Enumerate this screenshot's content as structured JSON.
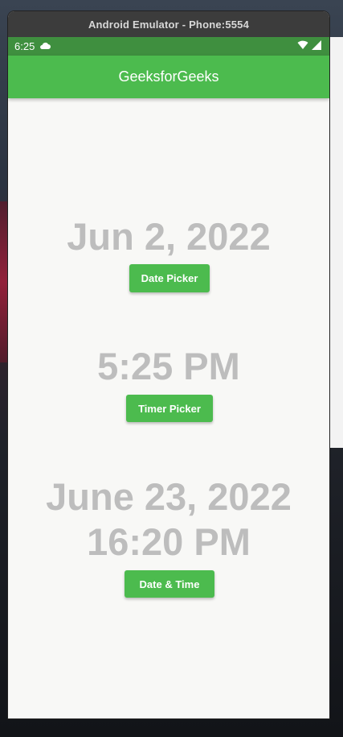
{
  "window": {
    "title": "Android Emulator - Phone:5554"
  },
  "status_bar": {
    "time": "6:25",
    "icons": [
      "cloud-icon",
      "wifi-icon",
      "signal-icon"
    ]
  },
  "app_bar": {
    "title": "GeeksforGeeks"
  },
  "date_section": {
    "value": "Jun 2, 2022",
    "button_label": "Date Picker"
  },
  "time_section": {
    "value": "5:25 PM",
    "button_label": "Timer Picker"
  },
  "datetime_section": {
    "value_line1": "June 23, 2022",
    "value_line2": "16:20 PM",
    "button_label": "Date & Time"
  },
  "colors": {
    "primary": "#4cbb4e",
    "status_bar": "#3f8f3f",
    "value_text": "#bdbdbd",
    "background": "#f8f8f6"
  }
}
